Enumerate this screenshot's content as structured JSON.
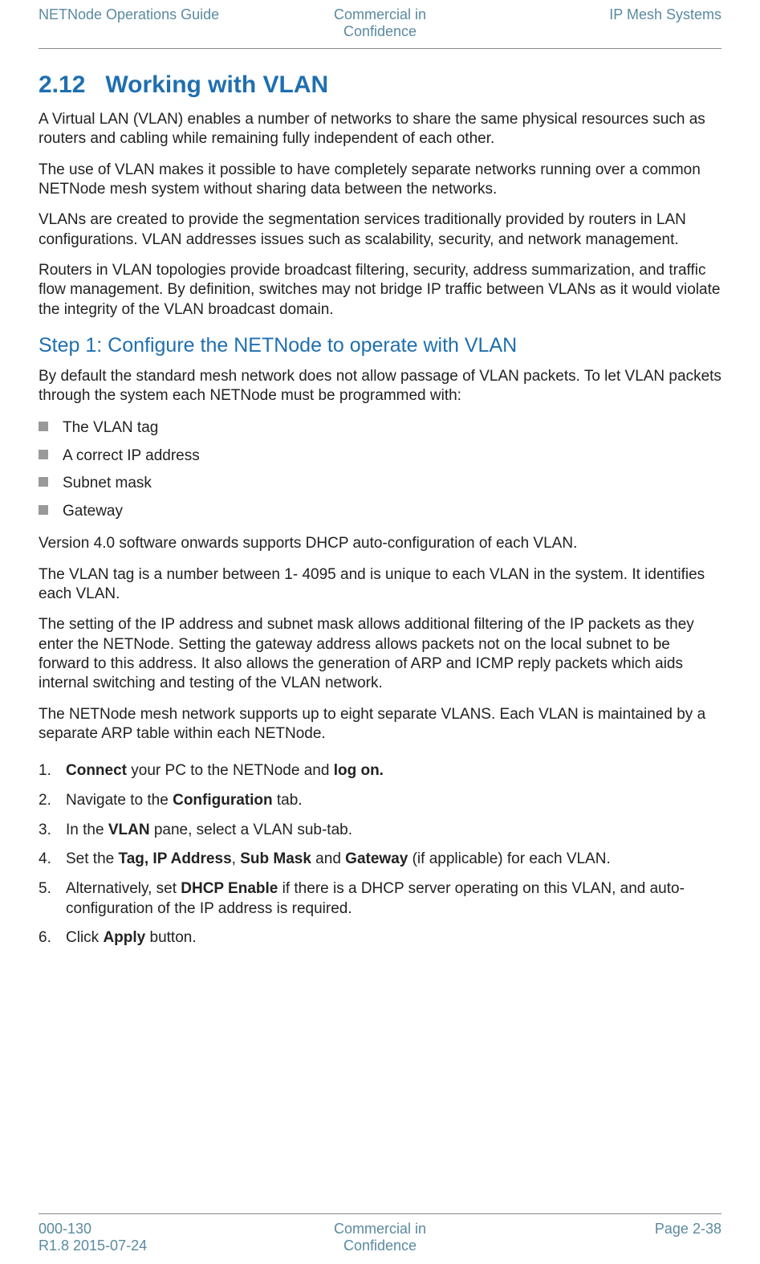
{
  "header": {
    "left": "NETNode Operations Guide",
    "center_line1": "Commercial in",
    "center_line2": "Confidence",
    "right": "IP Mesh Systems"
  },
  "section": {
    "number": "2.12",
    "title": "Working with VLAN"
  },
  "paragraphs": {
    "p1": "A Virtual LAN (VLAN) enables a number of networks to share the same physical resources such as routers and cabling while remaining fully independent of each other.",
    "p2": "The use of VLAN makes it possible to have completely separate networks running over a common NETNode mesh system without sharing data between the networks.",
    "p3": "VLANs are created to provide the segmentation services traditionally provided by routers in LAN configurations. VLAN addresses issues such as scalability, security, and network management.",
    "p4": "Routers in VLAN topologies provide broadcast filtering, security, address summarization, and traffic flow management. By definition, switches may not bridge IP traffic between VLANs as it would violate the integrity of the VLAN broadcast domain."
  },
  "step1": {
    "title": "Step 1: Configure the NETNode to operate with VLAN",
    "intro": "By default the standard mesh network does not allow passage of VLAN packets. To let VLAN packets through the system each NETNode must be programmed with:",
    "bullets": [
      "The VLAN tag",
      "A correct IP address",
      "Subnet mask",
      "Gateway"
    ],
    "after1": "Version 4.0 software onwards supports DHCP auto-configuration of each VLAN.",
    "after2": "The VLAN tag is a number between 1- 4095 and is unique to each VLAN in the system. It identifies each VLAN.",
    "after3": "The setting of the IP address and subnet mask allows additional filtering of the IP packets as they enter the NETNode. Setting the gateway address allows packets not on the local subnet to be forward to this address. It also allows the generation of ARP and ICMP reply packets which aids internal switching and testing of the VLAN network.",
    "after4": "The NETNode mesh network supports up to eight separate VLANS. Each VLAN is maintained by a separate ARP table within each NETNode."
  },
  "steps": {
    "s1_a": "Connect",
    "s1_b": " your PC to the NETNode and ",
    "s1_c": "log on.",
    "s2_a": "Navigate to the ",
    "s2_b": "Configuration",
    "s2_c": " tab.",
    "s3_a": "In the ",
    "s3_b": "VLAN",
    "s3_c": " pane, select a VLAN sub-tab.",
    "s4_a": "Set the ",
    "s4_b": "Tag, IP Address",
    "s4_c": ", ",
    "s4_d": "Sub Mask",
    "s4_e": " and ",
    "s4_f": "Gateway",
    "s4_g": " (if applicable) for each VLAN.",
    "s5_a": "Alternatively, set ",
    "s5_b": "DHCP Enable",
    "s5_c": " if there is a DHCP server operating on this VLAN, and auto-configuration of the IP address is required.",
    "s6_a": "Click ",
    "s6_b": "Apply",
    "s6_c": " button."
  },
  "footer": {
    "left_line1": "000-130",
    "left_line2": "R1.8 2015-07-24",
    "center_line1": "Commercial in",
    "center_line2": "Confidence",
    "right": "Page 2-38"
  }
}
